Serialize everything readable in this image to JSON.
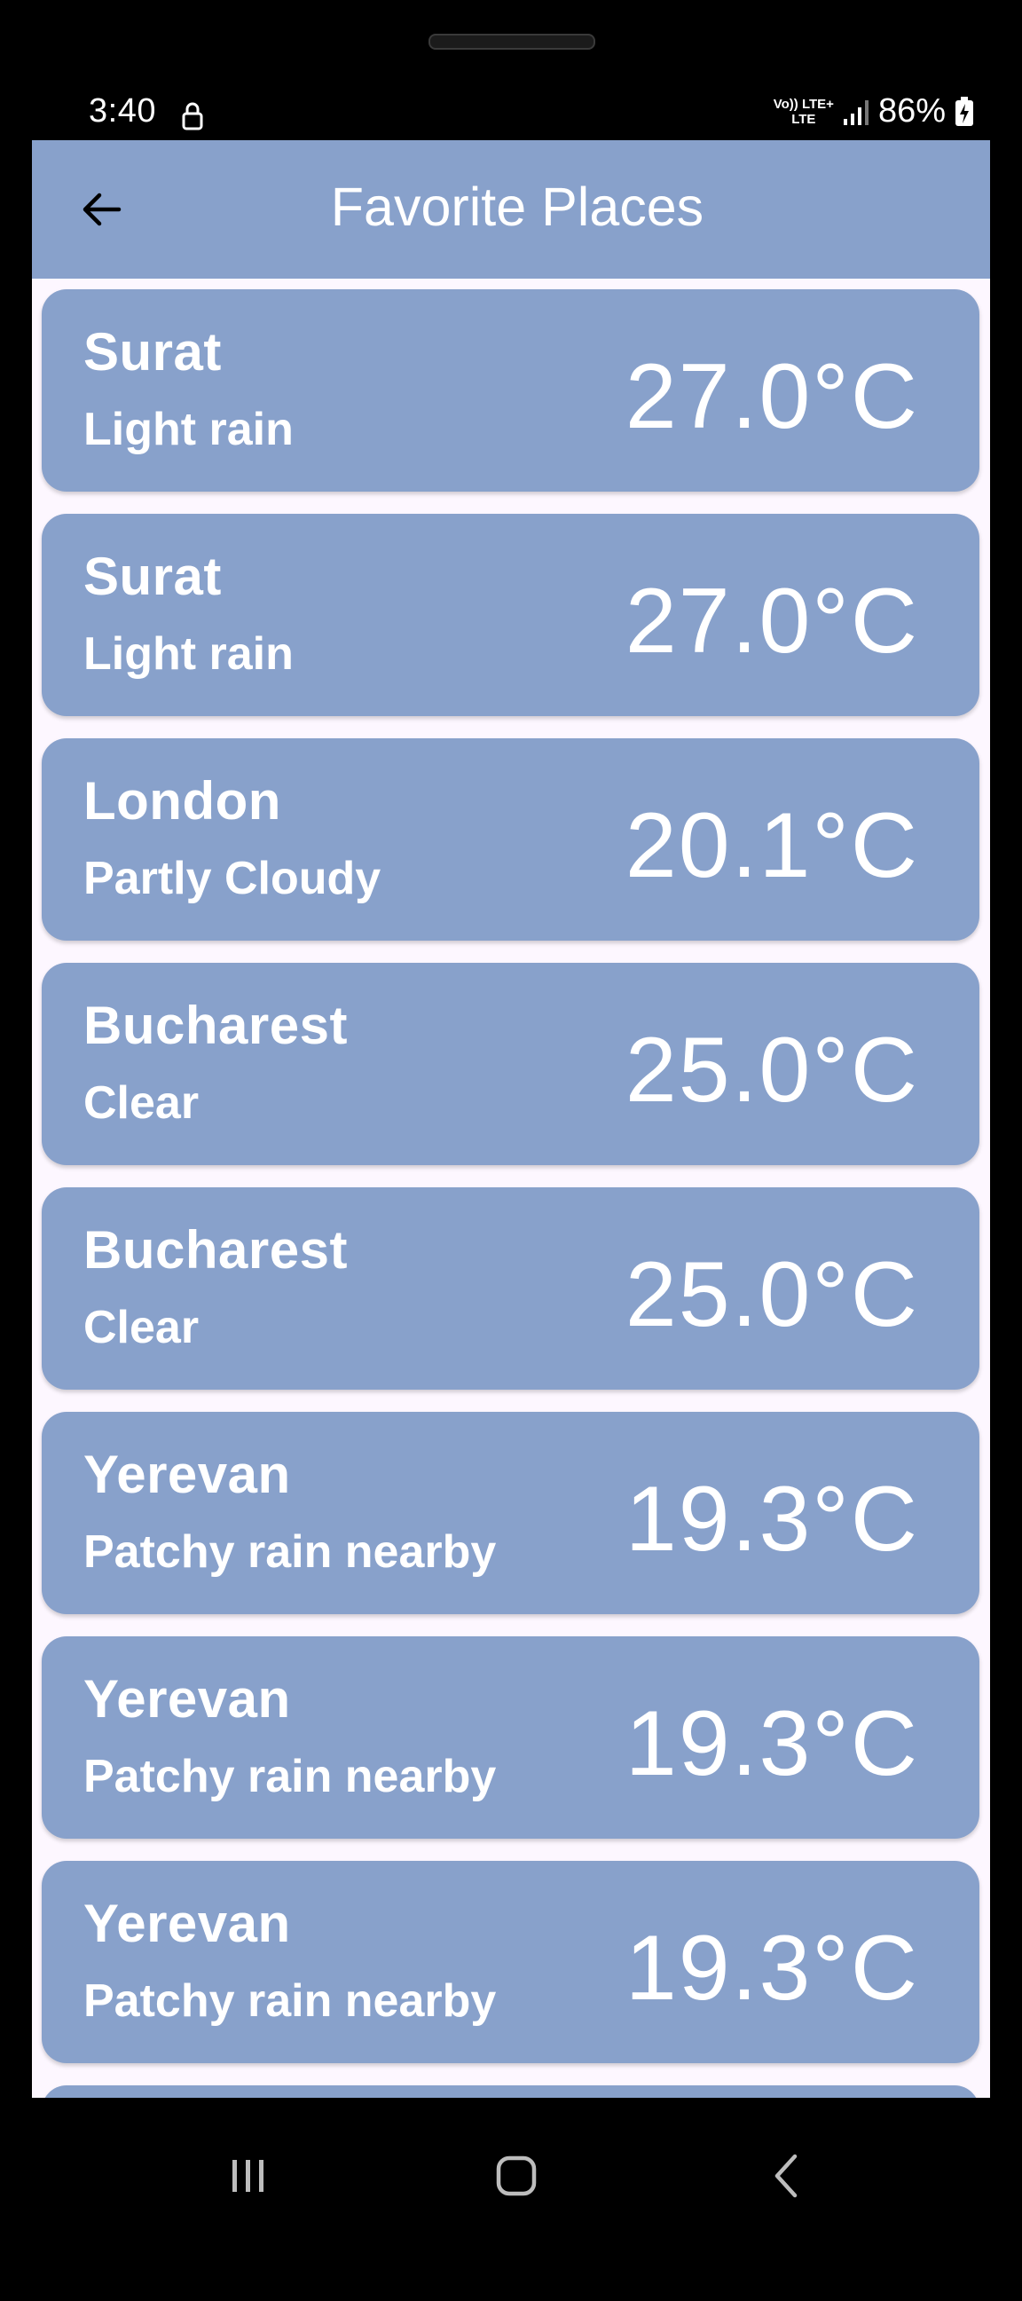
{
  "status_bar": {
    "time": "3:40",
    "network_top": "Vo)) LTE+",
    "network_bottom": "LTE",
    "battery": "86%"
  },
  "app_bar": {
    "title": "Favorite Places",
    "back_icon": "arrow-left-icon"
  },
  "places": [
    {
      "city": "Surat",
      "condition": "Light rain",
      "temperature": "27.0°C"
    },
    {
      "city": "Surat",
      "condition": "Light rain",
      "temperature": "27.0°C"
    },
    {
      "city": "London",
      "condition": "Partly Cloudy",
      "temperature": "20.1°C"
    },
    {
      "city": "Bucharest",
      "condition": "Clear",
      "temperature": "25.0°C"
    },
    {
      "city": "Bucharest",
      "condition": "Clear",
      "temperature": "25.0°C"
    },
    {
      "city": "Yerevan",
      "condition": "Patchy rain nearby",
      "temperature": "19.3°C"
    },
    {
      "city": "Yerevan",
      "condition": "Patchy rain nearby",
      "temperature": "19.3°C"
    },
    {
      "city": "Yerevan",
      "condition": "Patchy rain nearby",
      "temperature": "19.3°C"
    },
    {
      "city": "",
      "condition": "",
      "temperature": ""
    }
  ],
  "nav_bar": {
    "recents_icon": "recents-icon",
    "home_icon": "home-icon",
    "back_icon": "nav-back-icon"
  },
  "colors": {
    "primary": "#88a1cb",
    "background": "#fdf7ff",
    "text": "#ffffff"
  }
}
